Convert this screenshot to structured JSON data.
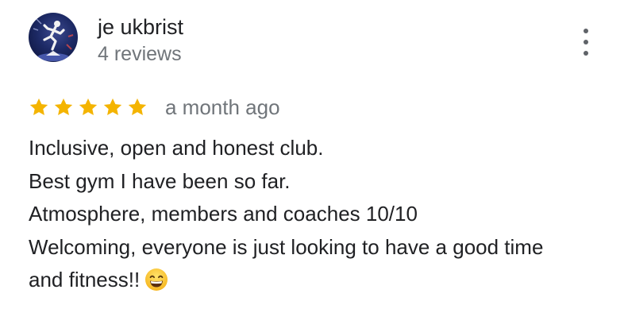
{
  "review": {
    "author": {
      "name": "je ukbrist",
      "review_count": "4 reviews",
      "avatar_icon": "runner-avatar-icon"
    },
    "menu_icon": "more-vert-icon",
    "rating": {
      "stars": 5,
      "max": 5,
      "star_color": "#f4b400"
    },
    "date": "a month ago",
    "text_lines": [
      "Inclusive, open and honest club.",
      "Best gym I have been so far.",
      "Atmosphere, members and coaches 10/10",
      "Welcoming, everyone is just looking to have a good time",
      "and fitness!!"
    ],
    "emoji": "grinning-face-emoji"
  }
}
